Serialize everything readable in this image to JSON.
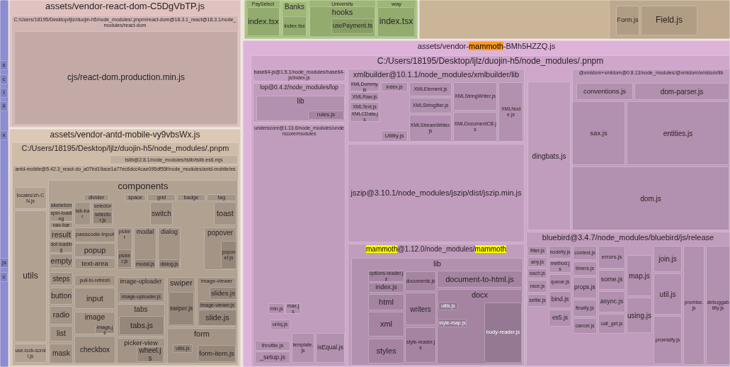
{
  "bundles": [
    {
      "color": "#8c8ccf",
      "children": [
        {
          "label": "s"
        },
        {
          "label": "c"
        },
        {
          "label": "t"
        },
        {
          "label": "ll"
        },
        {
          "label": "x"
        },
        {
          "label": "js"
        },
        {
          "label": "c"
        }
      ]
    },
    {
      "color": "#a9c47e",
      "children": [
        {
          "label": "PaySelect",
          "children": [
            {
              "label": "index.tsx"
            }
          ]
        },
        {
          "label": "Banks",
          "children": [
            {
              "label": "index.tsx"
            }
          ]
        },
        {
          "label": "University",
          "children": [
            {
              "label": "hooks",
              "children": [
                {
                  "label": "usePayment.ts"
                }
              ]
            }
          ]
        },
        {
          "label": "way",
          "children": [
            {
              "label": "index.tsx"
            }
          ]
        }
      ]
    },
    {
      "color": "#cbb598",
      "children": [
        {
          "children": [
            {
              "label": "Form.js"
            },
            {
              "label": "Field.js"
            }
          ]
        }
      ]
    },
    {
      "color": "#e0c3c0",
      "label": "assets/vendor-react-dom-C5DgVbTP.js",
      "children": [
        {
          "label": "C:/Users/18195/Desktop/ljlz/duojin-h5/node_modules/.pnpm/react-dom@18.3.1_react@18.3.1/node_modules/react-dom",
          "children": [
            {
              "label": "cjs/react-dom.production.min.js"
            }
          ]
        }
      ]
    },
    {
      "color": "#dcc8b4",
      "label": "assets/vendor-antd-mobile-vy9vbsWx.js",
      "children": [
        {
          "label": "C:/Users/18195/Desktop/ljlz/duojin-h5/node_modules/.pnpm",
          "children": [
            {
              "label": "tslib@2.8.1/node_modules/tslib/tslib.es6.mjs"
            },
            {
              "label": "antd-mobile@5.42.3_react-do_a07bd19ace1a77ec6dcc4cae095df55f/node_modules/antd-mobile/es",
              "children": [
                {
                  "label": "locales/zh-CN.js"
                },
                {
                  "label": "utils"
                },
                {
                  "label": "use-lock-scroll.js"
                },
                {
                  "label": "components",
                  "children": [
                    {
                      "label": "divider"
                    },
                    {
                      "label": "space"
                    },
                    {
                      "label": "grid"
                    },
                    {
                      "label": "badge"
                    },
                    {
                      "label": "tag"
                    },
                    {
                      "label": "skeleton"
                    },
                    {
                      "label": "spin-loading"
                    },
                    {
                      "label": "nav-bar"
                    },
                    {
                      "label": "tab-bar"
                    },
                    {
                      "label": "selector",
                      "children": [
                        {
                          "label": "selector.js"
                        }
                      ]
                    },
                    {
                      "label": "switch"
                    },
                    {
                      "label": "toast"
                    },
                    {
                      "label": "result"
                    },
                    {
                      "label": "dot-loading"
                    },
                    {
                      "label": "empty"
                    },
                    {
                      "label": "passcode-input"
                    },
                    {
                      "label": "popup"
                    },
                    {
                      "label": "text-area"
                    },
                    {
                      "label": "picker",
                      "children": [
                        {
                          "label": "picker.js"
                        }
                      ]
                    },
                    {
                      "label": "modal",
                      "children": [
                        {
                          "label": "modal.js"
                        }
                      ]
                    },
                    {
                      "label": "dialog",
                      "children": [
                        {
                          "label": "dialog.js"
                        }
                      ]
                    },
                    {
                      "label": "popover",
                      "children": [
                        {
                          "label": "popover.js"
                        }
                      ]
                    },
                    {
                      "label": "steps"
                    },
                    {
                      "label": "button"
                    },
                    {
                      "label": "radio"
                    },
                    {
                      "label": "list"
                    },
                    {
                      "label": "mask"
                    },
                    {
                      "label": "pull-to-refresh"
                    },
                    {
                      "label": "input"
                    },
                    {
                      "label": "image",
                      "children": [
                        {
                          "label": "image.js"
                        }
                      ]
                    },
                    {
                      "label": "checkbox"
                    },
                    {
                      "label": "image-uploader",
                      "children": [
                        {
                          "label": "image-uploader.js"
                        }
                      ]
                    },
                    {
                      "label": "tabs",
                      "children": [
                        {
                          "label": "tabs.js"
                        }
                      ]
                    },
                    {
                      "label": "picker-view",
                      "children": [
                        {
                          "label": "wheel.js"
                        }
                      ]
                    },
                    {
                      "label": "swiper",
                      "children": [
                        {
                          "label": "swiper.js"
                        }
                      ]
                    },
                    {
                      "label": "image-viewer",
                      "children": [
                        {
                          "label": "slides.js"
                        },
                        {
                          "label": "image-viewer.js"
                        },
                        {
                          "label": "slide.js"
                        }
                      ]
                    },
                    {
                      "label": "form",
                      "children": [
                        {
                          "label": "utils.js"
                        },
                        {
                          "label": "form-item.js"
                        }
                      ]
                    }
                  ]
                }
              ]
            }
          ]
        }
      ]
    },
    {
      "color": "#ddb3d9",
      "label_parts": [
        {
          "text": "assets/vendor-",
          "kind": "text"
        },
        {
          "text": "mammoth",
          "kind": "current-match"
        },
        {
          "text": "-BMh5HZZQ.js",
          "kind": "text"
        }
      ],
      "children": [
        {
          "label": "C:/Users/18195/Desktop/ljlz/duojin-h5/node_modules/.pnpm",
          "children": [
            {
              "label": "base64-js@1.5.1/node_modules/base64-js/index.js"
            },
            {
              "label": "lop@0.4.2/node_modules/lop",
              "children": [
                {
                  "label": "lib",
                  "children": [
                    {
                      "label": "rules.js"
                    }
                  ]
                }
              ]
            },
            {
              "label": "underscore@1.13.6/node_modules/underscore/modules",
              "children": [
                {
                  "label": "min.js"
                },
                {
                  "label": "max.js"
                },
                {
                  "label": "uniq.js"
                },
                {
                  "label": "throttle.js"
                },
                {
                  "label": "_setup.js"
                },
                {
                  "label": "template.js"
                },
                {
                  "label": "isEqual.js"
                }
              ]
            },
            {
              "label": "xmlbuilder@10.1.1/node_modules/xmlbuilder/lib",
              "children": [
                {
                  "label": "XMLDummy.js"
                },
                {
                  "label": "XMLRaw.js"
                },
                {
                  "label": "XMLText.js"
                },
                {
                  "label": "XMLCData.js"
                },
                {
                  "label": "index.js"
                },
                {
                  "label": "Utility.js"
                },
                {
                  "label": "XMLElement.js"
                },
                {
                  "label": "XMLStringWriter.js"
                },
                {
                  "label": "XMLStringifier.js"
                },
                {
                  "label": "XMLStreamWriter.js"
                },
                {
                  "label": "XMLDocumentCB.js"
                },
                {
                  "label": "XMLNode.js"
                }
              ]
            },
            {
              "label": "jszip@3.10.1/node_modules/jszip/dist/jszip.min.js"
            },
            {
              "label": "dingbats.js"
            },
            {
              "label": "@xmldom+xmldom@0.8.13/node_modules/@xmldom/xmldom/lib",
              "children": [
                {
                  "label": "conventions.js"
                },
                {
                  "label": "dom-parser.js"
                },
                {
                  "label": "sax.js"
                },
                {
                  "label": "entities.js"
                },
                {
                  "label": "dom.js"
                }
              ]
            },
            {
              "label_parts": [
                {
                  "text": "mammoth",
                  "kind": "match"
                },
                {
                  "text": "@1.12.0/node_modules/",
                  "kind": "text"
                },
                {
                  "text": "mammoth",
                  "kind": "match"
                }
              ],
              "children": [
                {
                  "label": "lib",
                  "children": [
                    {
                      "label": "options-reader.js"
                    },
                    {
                      "label": "index.js"
                    },
                    {
                      "label": "html"
                    },
                    {
                      "label": "xml"
                    },
                    {
                      "label": "styles"
                    },
                    {
                      "label": "documents.js"
                    },
                    {
                      "label": "writers"
                    },
                    {
                      "label": "style-reader.js"
                    },
                    {
                      "label": "document-to-html.js"
                    },
                    {
                      "label": "docx",
                      "children": [
                        {
                          "label": "utils.js"
                        },
                        {
                          "label": "style-map.js"
                        },
                        {
                          "label": "body-reader.js"
                        }
                      ]
                    }
                  ]
                }
              ]
            },
            {
              "label": "bluebird@3.4.7/node_modules/bluebird/js/release",
              "children": [
                {
                  "label": "filter.js"
                },
                {
                  "label": "any.js"
                },
                {
                  "label": "each.js"
                },
                {
                  "label": "race.js"
                },
                {
                  "label": "settle.js"
                },
                {
                  "label": "nodeify.js"
                },
                {
                  "label": "method.js"
                },
                {
                  "label": "queue.js"
                },
                {
                  "label": "bind.js"
                },
                {
                  "label": "es5.js"
                },
                {
                  "label": "context.js"
                },
                {
                  "label": "timers.js"
                },
                {
                  "label": "props.js"
                },
                {
                  "label": "finally.js"
                },
                {
                  "label": "cancel.js"
                },
                {
                  "label": "errors.js"
                },
                {
                  "label": "some.js"
                },
                {
                  "label": "async.js"
                },
                {
                  "label": "call_get.js"
                },
                {
                  "label": "map.js"
                },
                {
                  "label": "using.js"
                },
                {
                  "label": "join.js"
                },
                {
                  "label": "util.js"
                },
                {
                  "label": "promisify.js"
                },
                {
                  "label": "promise.js"
                },
                {
                  "label": "debuggability.js"
                }
              ]
            }
          ]
        }
      ]
    }
  ]
}
